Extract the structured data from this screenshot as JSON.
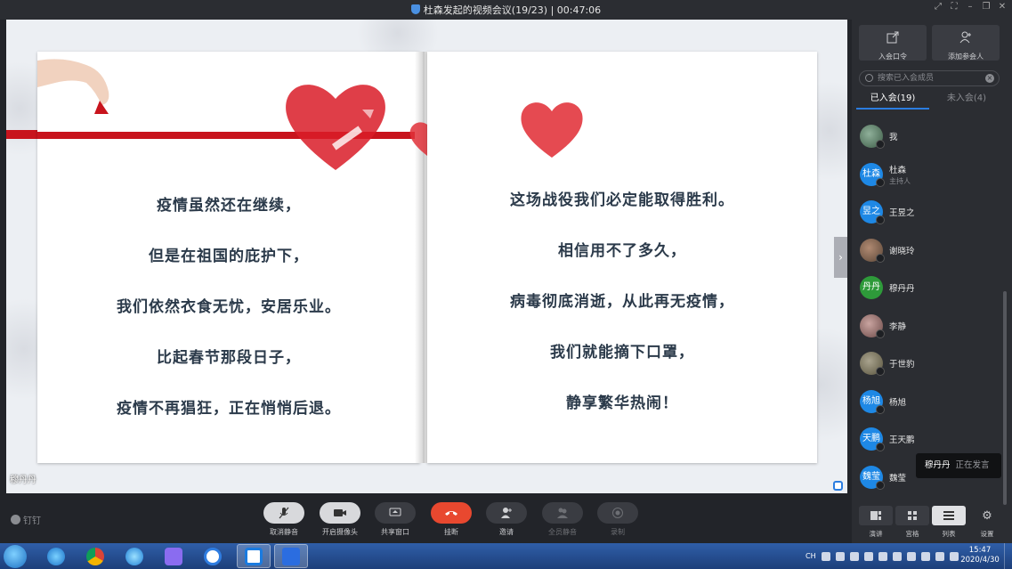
{
  "window": {
    "title": "杜森发起的视频会议(19/23) | 00:47:06"
  },
  "slide": {
    "left_lines": [
      "疫情虽然还在继续，",
      "但是在祖国的庇护下，",
      "我们依然衣食无忧，安居乐业。",
      "比起春节那段日子，",
      "疫情不再猖狂，正在悄悄后退。"
    ],
    "right_lines": [
      "这场战役我们必定能取得胜利。",
      "相信用不了多久，",
      "病毒彻底消逝，从此再无疫情，",
      "我们就能摘下口罩，",
      "静享繁华热闹！"
    ],
    "speaker_tag": "穆丹丹"
  },
  "toolbar": {
    "logo": "钉钉",
    "mute": "取消静音",
    "camera": "开启摄像头",
    "share": "共享窗口",
    "hangup": "挂断",
    "invite": "邀请",
    "mute_all": "全员静音",
    "record": "录制"
  },
  "panel": {
    "meeting_code": "入会口令",
    "add_member": "添加参会人",
    "search_placeholder": "搜索已入会成员",
    "tab_joined": "已入会(19)",
    "tab_not_joined": "未入会(4)",
    "members": [
      {
        "name": "我",
        "avatar": "",
        "role": ""
      },
      {
        "name": "杜森",
        "avatar": "杜森",
        "role": "主持人"
      },
      {
        "name": "王昱之",
        "avatar": "昱之",
        "role": ""
      },
      {
        "name": "谢晓玲",
        "avatar": "",
        "role": ""
      },
      {
        "name": "穆丹丹",
        "avatar": "丹丹",
        "role": ""
      },
      {
        "name": "李静",
        "avatar": "",
        "role": ""
      },
      {
        "name": "于世豹",
        "avatar": "",
        "role": ""
      },
      {
        "name": "杨旭",
        "avatar": "杨旭",
        "role": ""
      },
      {
        "name": "王天鹏",
        "avatar": "天鹏",
        "role": ""
      },
      {
        "name": "魏莹",
        "avatar": "魏莹",
        "role": ""
      }
    ],
    "speaking_name": "穆丹丹",
    "speaking_status": "正在发言",
    "view_speech": "演讲",
    "view_grid": "宫格",
    "view_list": "列表",
    "settings": "设置"
  },
  "taskbar": {
    "lang": "CH",
    "time": "15:47",
    "date": "2020/4/30"
  },
  "colors": {
    "accent": "#2b7de0",
    "hangup": "#e8482f",
    "ribbon": "#c8141d",
    "avatar_blue": "#1e88e5"
  }
}
